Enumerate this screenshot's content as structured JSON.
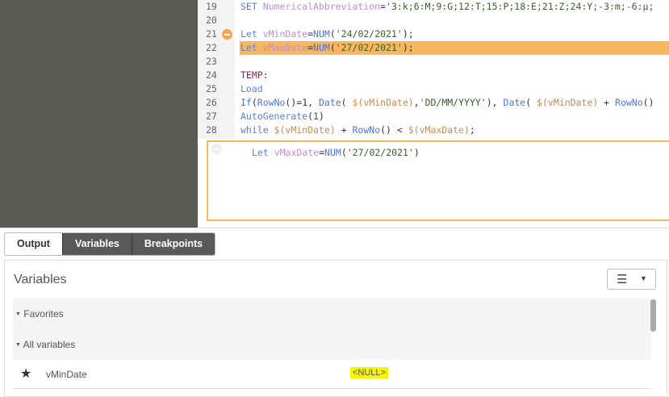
{
  "editor": {
    "lines": [
      {
        "n": "19",
        "parts": [
          [
            "kw",
            "SET "
          ],
          [
            "var",
            "NumericalAbbreviation"
          ],
          [
            "p",
            "="
          ],
          [
            "str",
            "'3:k;6:M;9:G;12:T;15:P;18:E;21:Z;24:Y;-3:m;-6:μ;"
          ]
        ]
      },
      {
        "n": "20",
        "parts": []
      },
      {
        "n": "21",
        "bp": true,
        "parts": [
          [
            "kw",
            "Let "
          ],
          [
            "var",
            "vMinDate"
          ],
          [
            "p",
            "="
          ],
          [
            "fn",
            "NUM"
          ],
          [
            "p",
            "("
          ],
          [
            "str",
            "'24/02/2021'"
          ],
          [
            "p",
            ");"
          ]
        ]
      },
      {
        "n": "22",
        "hl": true,
        "parts": [
          [
            "kw",
            "Let "
          ],
          [
            "var",
            "vMaxDate"
          ],
          [
            "p",
            "="
          ],
          [
            "fn",
            "NUM"
          ],
          [
            "p",
            "("
          ],
          [
            "str",
            "'27/02/2021'"
          ],
          [
            "p",
            ");"
          ]
        ]
      },
      {
        "n": "23",
        "parts": []
      },
      {
        "n": "24",
        "parts": [
          [
            "lbl",
            "TEMP"
          ],
          [
            "p",
            ":"
          ]
        ]
      },
      {
        "n": "25",
        "parts": [
          [
            "kw",
            "Load"
          ]
        ]
      },
      {
        "n": "26",
        "parts": [
          [
            "fn",
            "If"
          ],
          [
            "p",
            "("
          ],
          [
            "fn",
            "RowNo"
          ],
          [
            "p",
            "()=1, "
          ],
          [
            "fn",
            "Date"
          ],
          [
            "p",
            "( "
          ],
          [
            "dol",
            "$(vMinDate)"
          ],
          [
            "p",
            ","
          ],
          [
            "str",
            "'DD/MM/YYYY'"
          ],
          [
            "p",
            "), "
          ],
          [
            "fn",
            "Date"
          ],
          [
            "p",
            "( "
          ],
          [
            "dol",
            "$(vMinDate)"
          ],
          [
            "p",
            " + "
          ],
          [
            "fn",
            "RowNo"
          ],
          [
            "p",
            "()"
          ]
        ]
      },
      {
        "n": "27",
        "parts": [
          [
            "kw",
            "AutoGenerate"
          ],
          [
            "p",
            "("
          ],
          [
            "num",
            "1"
          ],
          [
            "p",
            ")"
          ]
        ]
      },
      {
        "n": "28",
        "parts": [
          [
            "kw",
            "while "
          ],
          [
            "dol",
            "$(vMinDate)"
          ],
          [
            "p",
            " + "
          ],
          [
            "fn",
            "RowNo"
          ],
          [
            "p",
            "() < "
          ],
          [
            "dol",
            "$(vMaxDate)"
          ],
          [
            "p",
            ";"
          ]
        ]
      }
    ],
    "inspect": [
      [
        "kw",
        "Let "
      ],
      [
        "var",
        "vMaxDate"
      ],
      [
        "p",
        "="
      ],
      [
        "fn",
        "NUM"
      ],
      [
        "p",
        "("
      ],
      [
        "str",
        "'27/02/2021'"
      ],
      [
        "p",
        ")"
      ]
    ]
  },
  "tabs": [
    {
      "label": "Output",
      "active": true
    },
    {
      "label": "Variables"
    },
    {
      "label": "Breakpoints"
    }
  ],
  "panel": {
    "title": "Variables",
    "menu_icon": "hamburger-icon",
    "groups": {
      "favorites": "Favorites",
      "all": "All variables"
    },
    "variables": [
      {
        "name": "vMinDate",
        "value": "<NULL>",
        "favorite": true
      }
    ]
  },
  "colors": {
    "highlight": "#f8b65e",
    "null_highlight": "#f5f500"
  }
}
